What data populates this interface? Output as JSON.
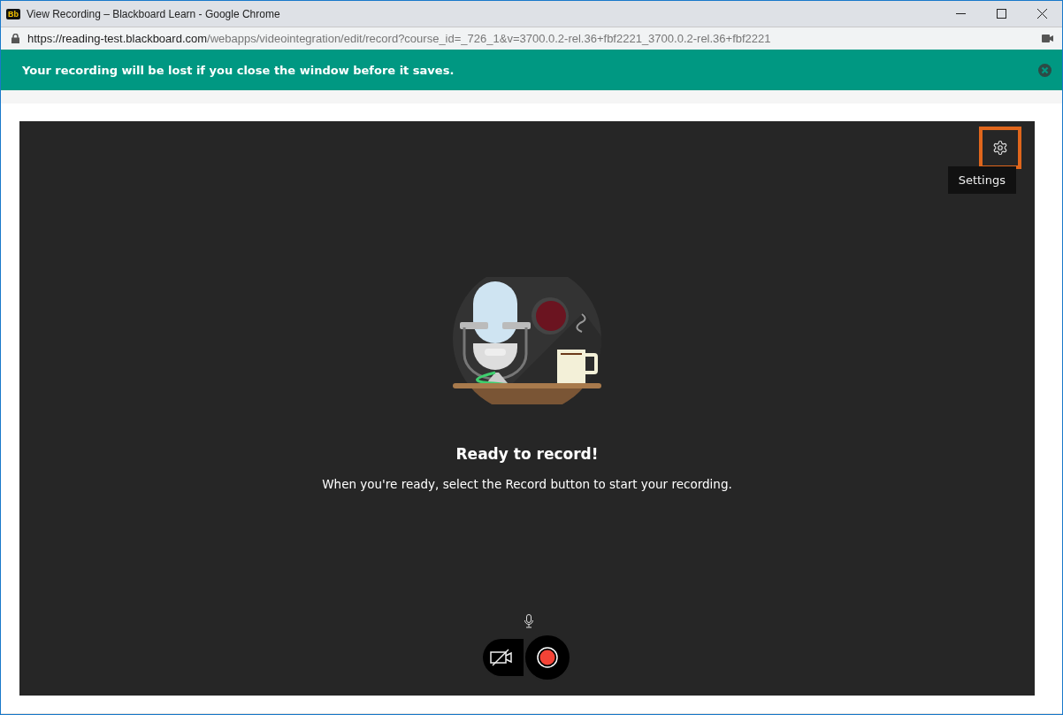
{
  "window": {
    "title": "View Recording – Blackboard Learn - Google Chrome",
    "favicon": "Bb"
  },
  "address_bar": {
    "host": "https://reading-test.blackboard.com",
    "path": "/webapps/videointegration/edit/record?course_id=_726_1&v=3700.0.2-rel.36+fbf2221_3700.0.2-rel.36+fbf2221"
  },
  "banner": {
    "message": "Your recording will be lost if you close the window before it saves."
  },
  "recorder": {
    "settings": {
      "focused": true,
      "tooltip": "Settings"
    },
    "heading": "Ready to record!",
    "instructions": "When you're ready, select the Record button to start your recording.",
    "camera": {
      "on": false
    }
  }
}
